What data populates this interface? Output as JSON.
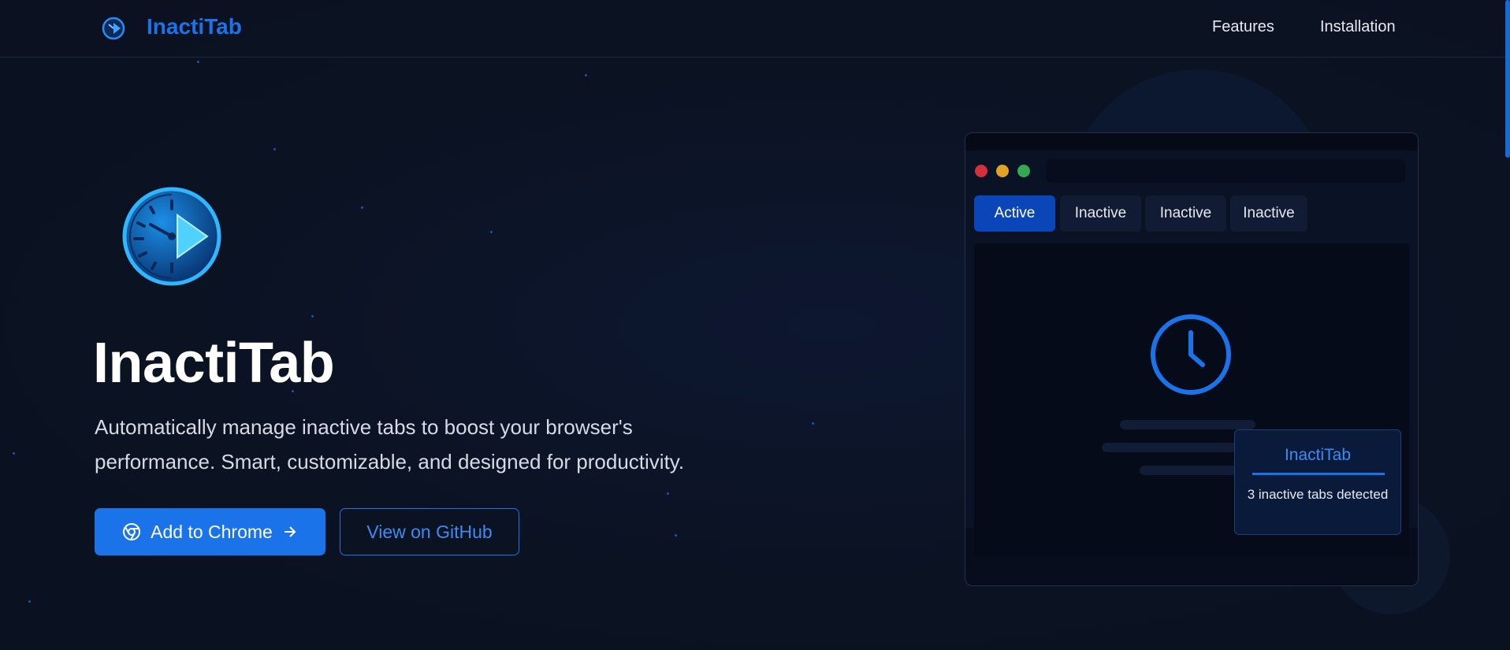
{
  "header": {
    "brand": "InactiTab",
    "nav": {
      "features": "Features",
      "installation": "Installation"
    }
  },
  "hero": {
    "title": "InactiTab",
    "description": "Automatically manage inactive tabs to boost your browser's performance. Smart, customizable, and designed for productivity.",
    "primary_button": "Add to Chrome",
    "secondary_button": "View on GitHub"
  },
  "mock_browser": {
    "tabs": [
      "Active",
      "Inactive",
      "Inactive",
      "Inactive"
    ],
    "popup": {
      "title": "InactiTab",
      "message": "3 inactive tabs detected"
    }
  },
  "icons": {
    "logo": "clock-play-icon",
    "primary_button": "chrome-icon",
    "primary_button_trailing": "arrow-right-icon",
    "mock_content": "clock-icon"
  },
  "colors": {
    "background": "#0b1222",
    "accent": "#1a73e8",
    "active_tab": "#0b46b8",
    "traffic_red": "#d2303d",
    "traffic_yellow": "#e0a227",
    "traffic_green": "#35a853"
  }
}
